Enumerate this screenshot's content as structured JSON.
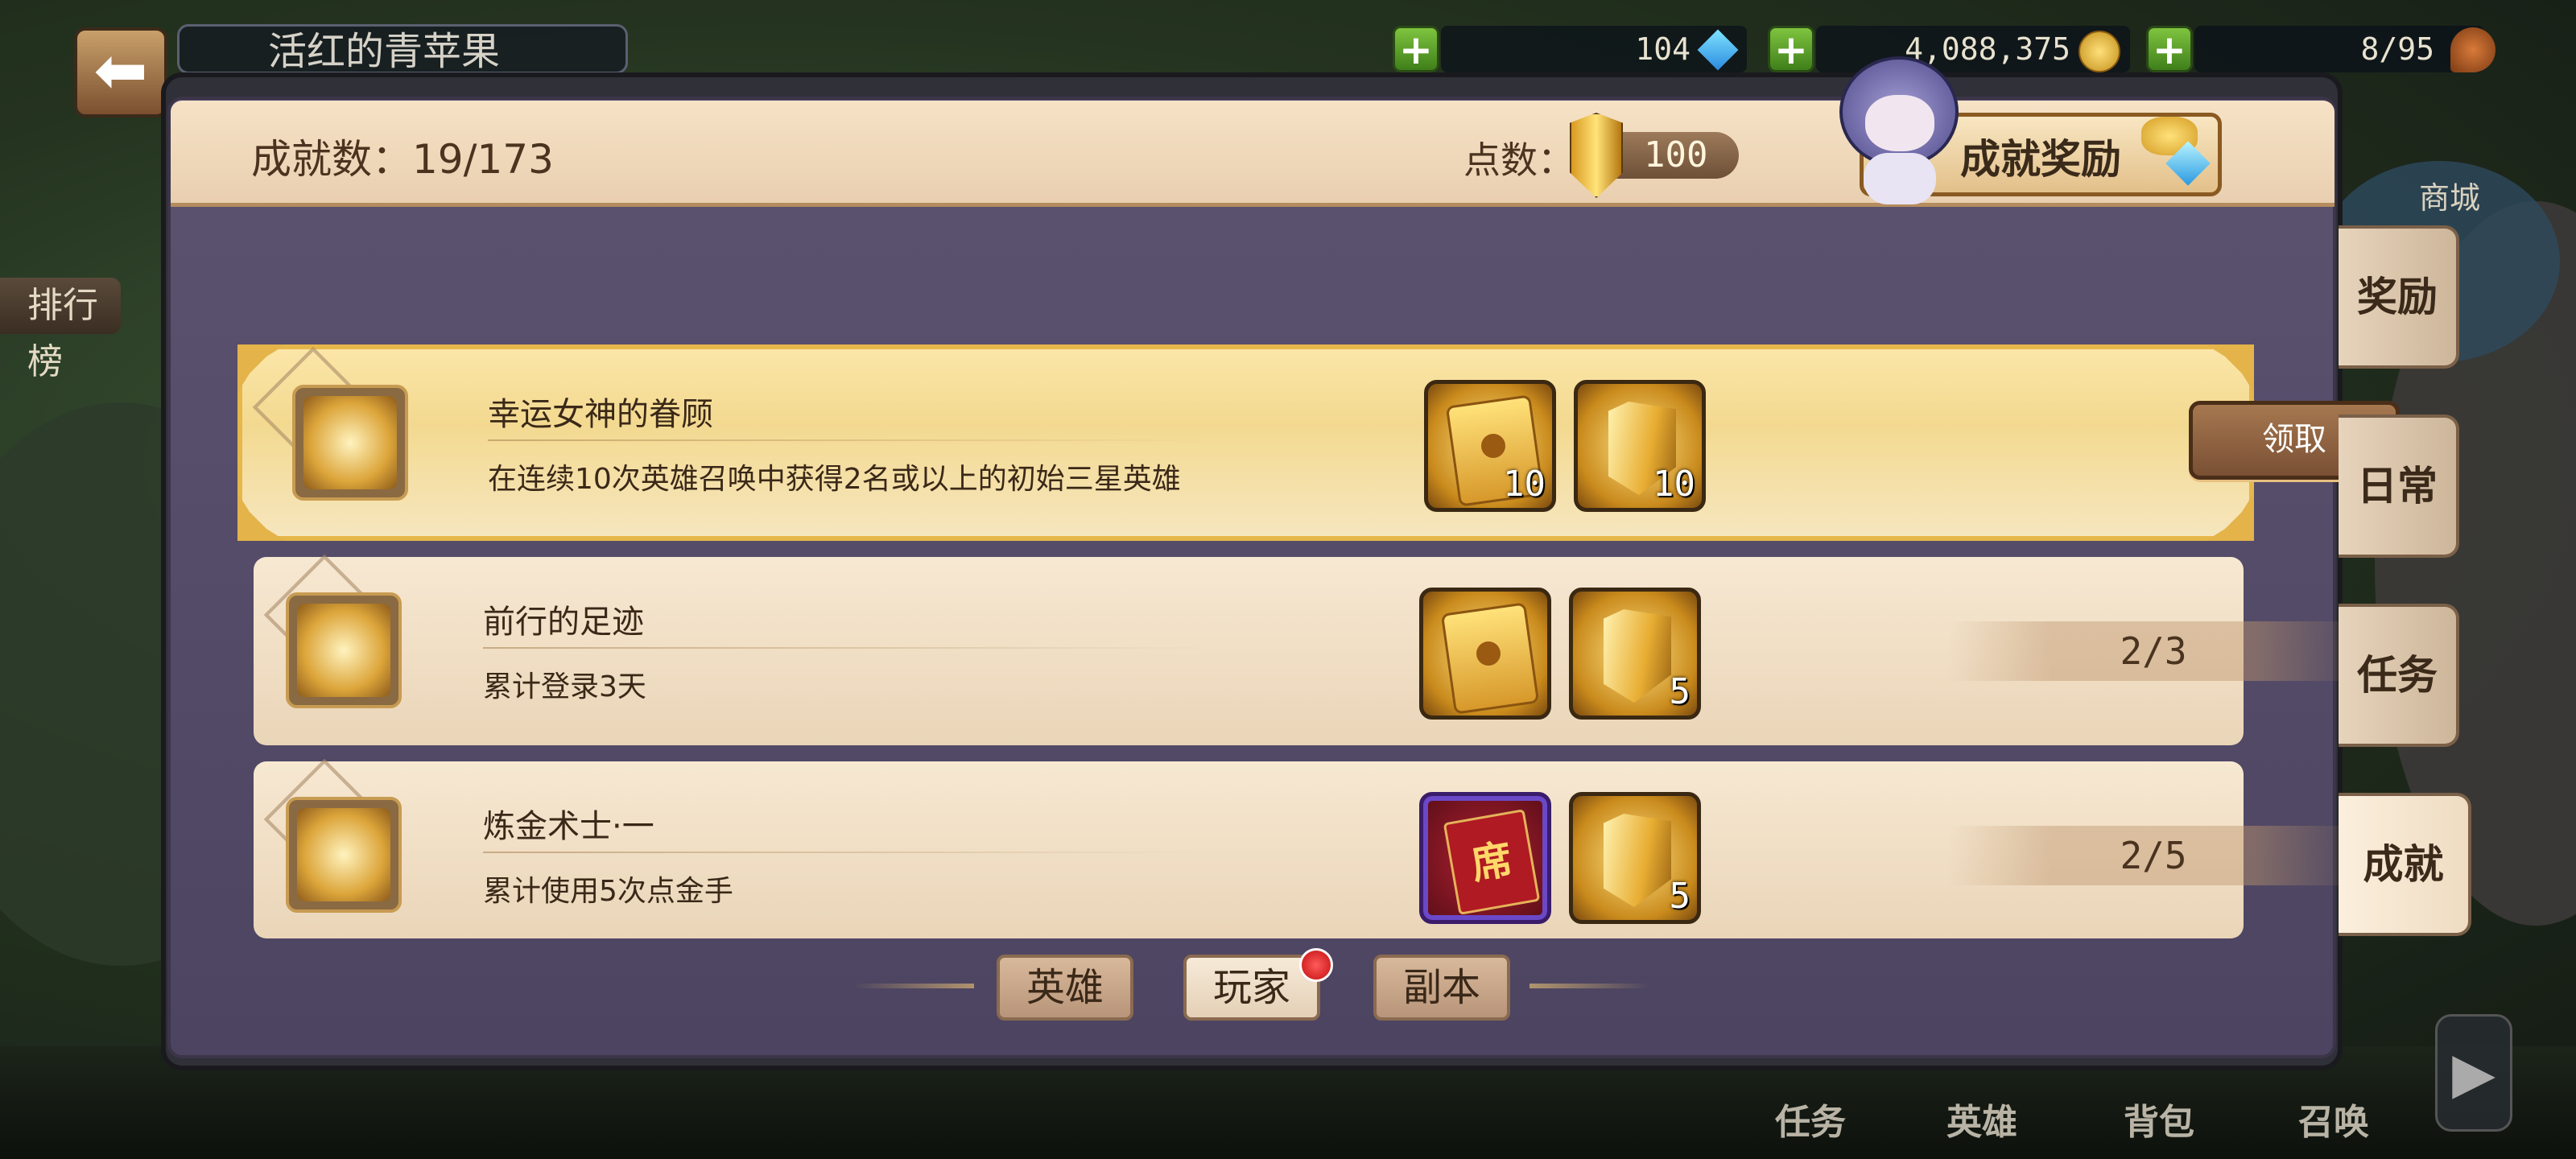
{
  "hud": {
    "title_partial": "活红的青苹果",
    "gems": "104",
    "gold": "4,088,375",
    "stamina": "8/95",
    "plus_label": "+",
    "back_label": "⬅"
  },
  "background": {
    "left_label": "排行榜",
    "shop_label": "商城",
    "nav": [
      "任务",
      "英雄",
      "背包",
      "召唤"
    ],
    "next_arrow": "▶"
  },
  "header": {
    "achievement_count": "成就数：19/173",
    "points_label": "点数：",
    "points_value": "100",
    "reward_button": "成就奖励"
  },
  "achievements": [
    {
      "title": "幸运女神的眷顾",
      "desc": "在连续10次英雄召唤中获得2名或以上的初始三星英雄",
      "rewards": [
        {
          "kind": "summon-card",
          "qty": "10"
        },
        {
          "kind": "achievement-shield",
          "qty": "10"
        }
      ],
      "action": "领取"
    },
    {
      "title": "前行的足迹",
      "desc": "累计登录3天",
      "rewards": [
        {
          "kind": "summon-card",
          "qty": ""
        },
        {
          "kind": "achievement-shield",
          "qty": "5"
        }
      ],
      "progress": "2/3"
    },
    {
      "title": "炼金术士·一",
      "desc": "累计使用5次点金手",
      "rewards": [
        {
          "kind": "red-scroll",
          "qty": "",
          "glyph": "席"
        },
        {
          "kind": "achievement-shield",
          "qty": "5"
        }
      ],
      "progress": "2/5"
    }
  ],
  "side_tabs": [
    "奖励",
    "日常",
    "任务",
    "成就"
  ],
  "category_tabs": [
    "英雄",
    "玩家",
    "副本"
  ],
  "colors": {
    "panel": "#5c5370",
    "header": "#f6e2c6",
    "highlight_border": "#e6b74a",
    "badge": "#c20e0e"
  }
}
